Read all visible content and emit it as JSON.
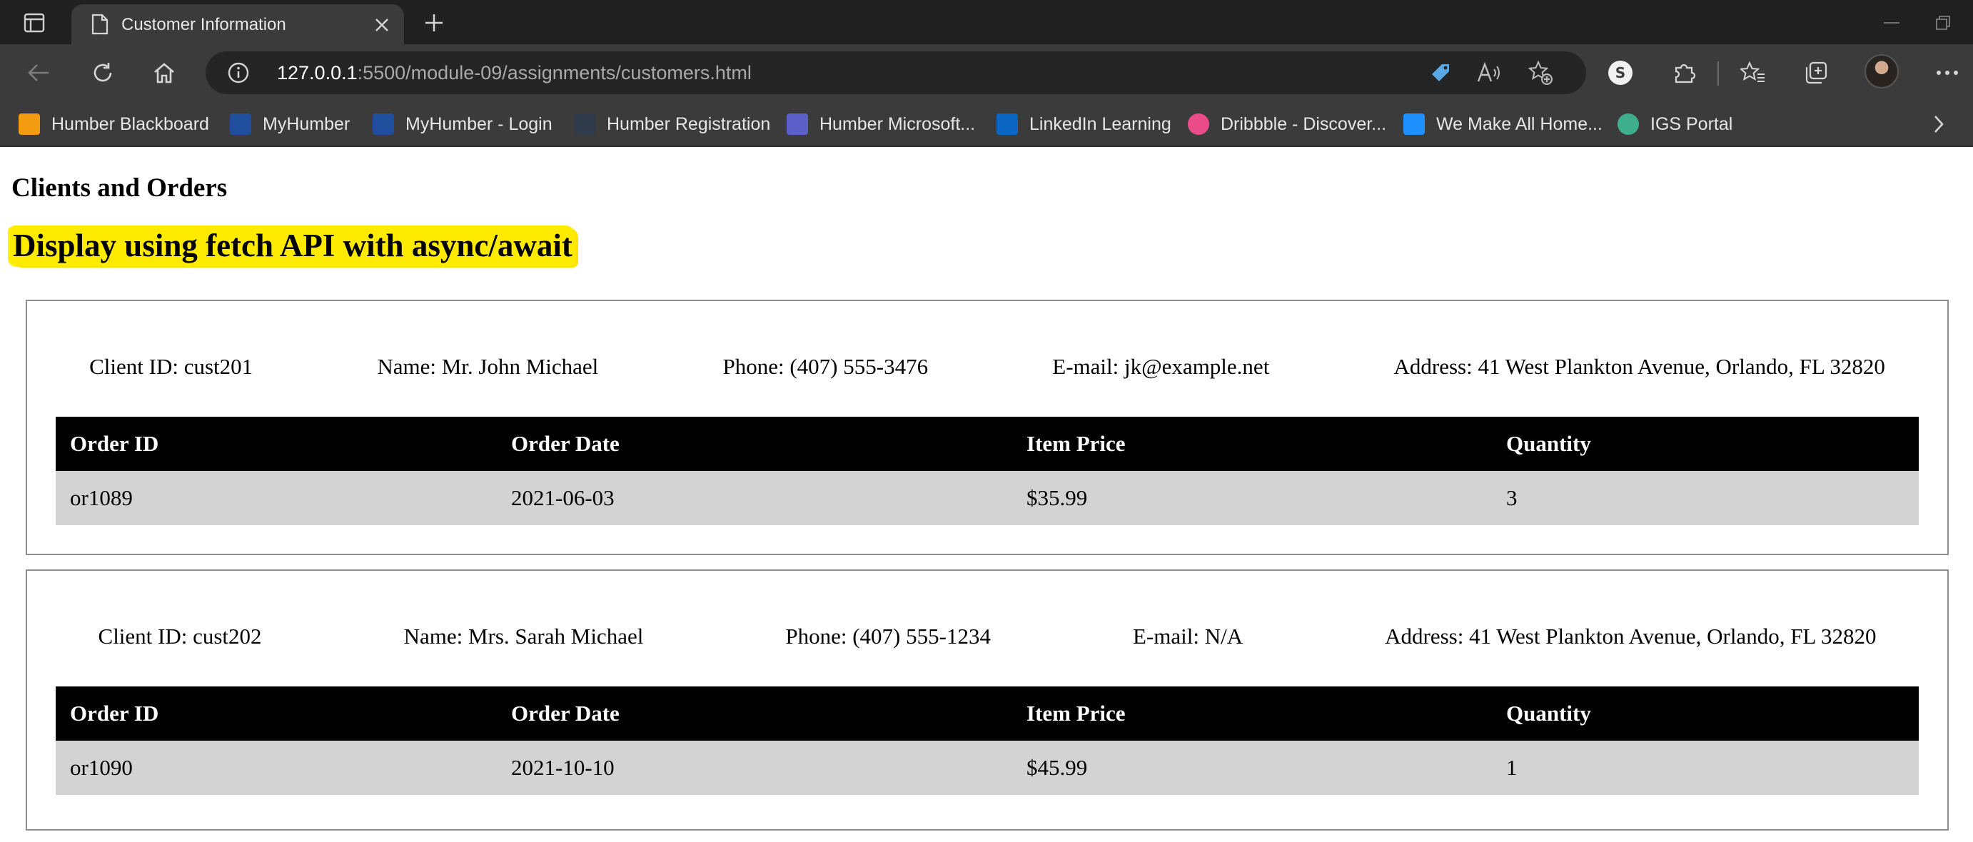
{
  "browser": {
    "tab_title": "Customer Information",
    "url_host": "127.0.0.1",
    "url_rest": ":5500/module-09/assignments/customers.html",
    "bookmarks": [
      {
        "label": "Humber Blackboard",
        "icon": "blackboard-icon",
        "color": "#f39c12"
      },
      {
        "label": "MyHumber",
        "icon": "myhumber-icon",
        "color": "#1f4e9c"
      },
      {
        "label": "MyHumber - Login",
        "icon": "myhumber-login-icon",
        "color": "#1f4e9c"
      },
      {
        "label": "Humber Registration",
        "icon": "registration-icon",
        "color": "#2f3a4a"
      },
      {
        "label": "Humber Microsoft...",
        "icon": "teams-icon",
        "color": "#5b5fc7"
      },
      {
        "label": "LinkedIn Learning",
        "icon": "linkedin-learning-icon",
        "color": "#0a66c2"
      },
      {
        "label": "Dribbble - Discover...",
        "icon": "dribbble-icon",
        "color": "#ea4c89"
      },
      {
        "label": "We Make All Home...",
        "icon": "kijiji-icon",
        "color": "#1e90ff"
      },
      {
        "label": "IGS Portal",
        "icon": "igs-icon",
        "color": "#3fae8c"
      }
    ]
  },
  "page": {
    "subtitle": "Clients and Orders",
    "heading": "Display using fetch API with async/await",
    "heading_highlight": "#ffeb00",
    "table_headers": [
      "Order ID",
      "Order Date",
      "Item Price",
      "Quantity"
    ],
    "clients": [
      {
        "client_id": "Client ID: cust201",
        "name": "Name: Mr. John Michael",
        "phone": "Phone: (407) 555-3476",
        "email": "E-mail: jk@example.net",
        "address": "Address: 41 West Plankton Avenue, Orlando, FL 32820",
        "orders": [
          {
            "order_id": "or1089",
            "order_date": "2021-06-03",
            "item_price": "$35.99",
            "quantity": "3"
          }
        ]
      },
      {
        "client_id": "Client ID: cust202",
        "name": "Name: Mrs. Sarah Michael",
        "phone": "Phone: (407) 555-1234",
        "email": "E-mail: N/A",
        "address": "Address: 41 West Plankton Avenue, Orlando, FL 32820",
        "orders": [
          {
            "order_id": "or1090",
            "order_date": "2021-10-10",
            "item_price": "$45.99",
            "quantity": "1"
          }
        ]
      }
    ]
  }
}
